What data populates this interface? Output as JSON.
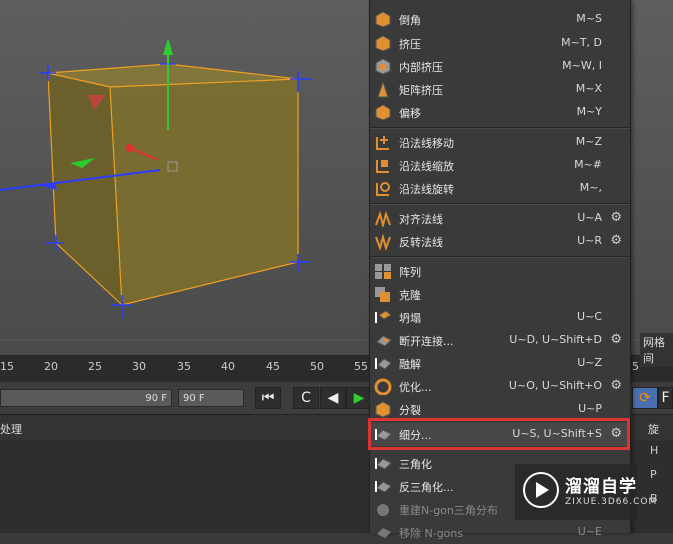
{
  "timeline": {
    "ticks": [
      "15",
      "20",
      "25",
      "30",
      "35",
      "40",
      "45",
      "50",
      "55",
      "5"
    ]
  },
  "transport": {
    "frame_end_left": "90 F",
    "frame_end_right": "90 F"
  },
  "attributes": {
    "left_label": "处理",
    "right_label_top": "网格间",
    "right_label_mid": "旋",
    "axis_labels": [
      "H",
      "P",
      "B"
    ]
  },
  "menu": {
    "items": [
      {
        "label": "倒角",
        "shortcut": "M~S",
        "icon": "bevel-icon"
      },
      {
        "label": "挤压",
        "shortcut": "M~T, D",
        "icon": "extrude-icon"
      },
      {
        "label": "内部挤压",
        "shortcut": "M~W, I",
        "icon": "extrude-inner-icon"
      },
      {
        "label": "矩阵挤压",
        "shortcut": "M~X",
        "icon": "matrix-extrude-icon"
      },
      {
        "label": "偏移",
        "shortcut": "M~Y",
        "icon": "offset-icon"
      },
      {
        "label": "沿法线移动",
        "shortcut": "M~Z",
        "icon": "normal-move-icon"
      },
      {
        "label": "沿法线缩放",
        "shortcut": "M~#",
        "icon": "normal-scale-icon"
      },
      {
        "label": "沿法线旋转",
        "shortcut": "M~,",
        "icon": "normal-rotate-icon"
      },
      {
        "label": "对齐法线",
        "shortcut": "U~A",
        "icon": "align-normals-icon",
        "gear": true
      },
      {
        "label": "反转法线",
        "shortcut": "U~R",
        "icon": "reverse-normals-icon",
        "gear": true
      },
      {
        "label": "阵列",
        "shortcut": "",
        "icon": "array-icon"
      },
      {
        "label": "克隆",
        "shortcut": "",
        "icon": "clone-icon"
      },
      {
        "label": "坍塌",
        "shortcut": "U~C",
        "icon": "collapse-icon"
      },
      {
        "label": "断开连接...",
        "shortcut": "U~D, U~Shift+D",
        "icon": "disconnect-icon",
        "gear": true
      },
      {
        "label": "融解",
        "shortcut": "U~Z",
        "icon": "melt-icon"
      },
      {
        "label": "优化...",
        "shortcut": "U~O, U~Shift+O",
        "icon": "optimize-icon",
        "gear": true
      },
      {
        "label": "分裂",
        "shortcut": "U~P",
        "icon": "split-icon"
      },
      {
        "label": "细分...",
        "shortcut": "U~S, U~Shift+S",
        "icon": "subdivide-icon",
        "gear": true
      },
      {
        "label": "三角化",
        "shortcut": "",
        "icon": "triangulate-icon"
      },
      {
        "label": "反三角化...",
        "shortcut": "",
        "icon": "untriangulate-icon"
      },
      {
        "label": "重建N-gon三角分布",
        "shortcut": "",
        "icon": "retriangulate-ngons-icon"
      },
      {
        "label": "移除 N-gons",
        "shortcut": "U~E",
        "icon": "remove-ngons-icon"
      }
    ]
  },
  "watermark": {
    "title": "溜溜自学",
    "subtitle": "ZIXUE.3D66.COM"
  },
  "colors": {
    "accent_highlight": "#d33333",
    "cube_fill": "#8a7a2a",
    "cube_edge": "#f0a020"
  }
}
